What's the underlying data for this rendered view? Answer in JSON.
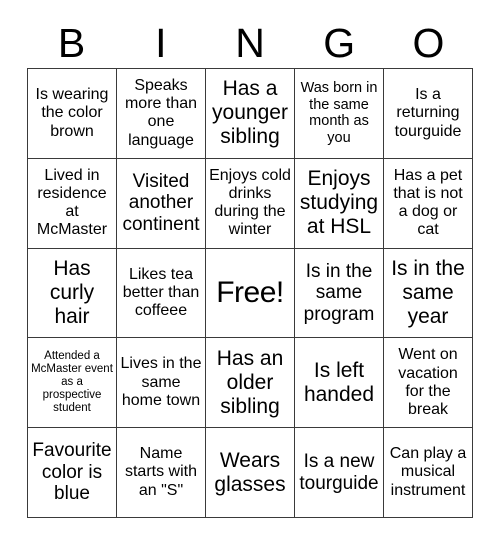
{
  "card": {
    "title": "BINGO",
    "header_letters": [
      "B",
      "I",
      "N",
      "G",
      "O"
    ],
    "rows": 5,
    "columns": 5,
    "border_color": "#3a3a3a",
    "background_color": "#ffffff",
    "text_color": "#000000",
    "cells": [
      [
        {
          "text": "Is wearing the color brown",
          "size": "m",
          "free": false
        },
        {
          "text": "Speaks more than one language",
          "size": "m",
          "free": false
        },
        {
          "text": "Has a younger sibling",
          "size": "xl",
          "free": false
        },
        {
          "text": "Was born in the same month as you",
          "size": "s",
          "free": false
        },
        {
          "text": "Is a returning tourguide",
          "size": "m",
          "free": false
        }
      ],
      [
        {
          "text": "Lived in residence at McMaster",
          "size": "m",
          "free": false
        },
        {
          "text": "Visited another continent",
          "size": "l",
          "free": false
        },
        {
          "text": "Enjoys cold drinks during the winter",
          "size": "m",
          "free": false
        },
        {
          "text": "Enjoys studying at HSL",
          "size": "xl",
          "free": false
        },
        {
          "text": "Has a pet that is not a dog or cat",
          "size": "m",
          "free": false
        }
      ],
      [
        {
          "text": "Has curly hair",
          "size": "xl",
          "free": false
        },
        {
          "text": "Likes tea better than coffeee",
          "size": "m",
          "free": false
        },
        {
          "text": "Free!",
          "size": "xxl",
          "free": true
        },
        {
          "text": "Is in the same program",
          "size": "l",
          "free": false
        },
        {
          "text": "Is in the same year",
          "size": "xl",
          "free": false
        }
      ],
      [
        {
          "text": "Attended a McMaster event as a prospective student",
          "size": "xs",
          "free": false
        },
        {
          "text": "Lives in the same home town",
          "size": "m",
          "free": false
        },
        {
          "text": "Has an older sibling",
          "size": "xl",
          "free": false
        },
        {
          "text": "Is left handed",
          "size": "xl",
          "free": false
        },
        {
          "text": "Went on vacation for the break",
          "size": "m",
          "free": false
        }
      ],
      [
        {
          "text": "Favourite color is blue",
          "size": "l",
          "free": false
        },
        {
          "text": "Name starts with an \"S\"",
          "size": "m",
          "free": false
        },
        {
          "text": "Wears glasses",
          "size": "xl",
          "free": false
        },
        {
          "text": "Is a new tourguide",
          "size": "l",
          "free": false
        },
        {
          "text": "Can play a musical instrument",
          "size": "m",
          "free": false
        }
      ]
    ]
  }
}
